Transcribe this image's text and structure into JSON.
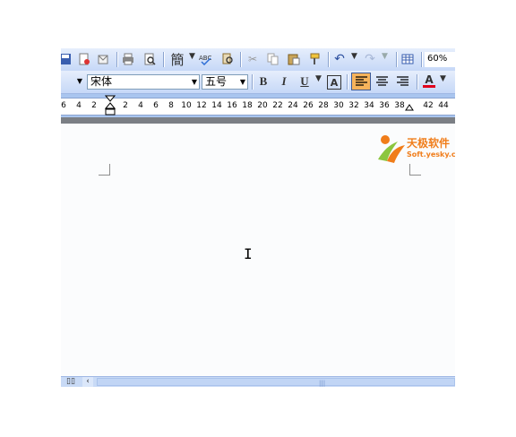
{
  "toolbar": {
    "simplified_char": "簡",
    "zoom": "60%",
    "icons": [
      "save-icon",
      "permission-icon",
      "print-icon",
      "print-preview-icon",
      "simplified-chinese-icon",
      "spelling-icon",
      "research-icon",
      "cut-icon",
      "copy-icon",
      "paste-icon",
      "format-painter-icon",
      "undo-icon",
      "redo-icon",
      "insert-table-icon"
    ]
  },
  "formatting": {
    "font_name": "宋体",
    "font_size": "五号",
    "bold": "B",
    "italic": "I",
    "underline": "U",
    "char_border": "A",
    "font_color": "A",
    "font_color_hex": "#e0001b",
    "active_align": "align-left"
  },
  "ruler": {
    "left_labels": [
      "6",
      "4",
      "2"
    ],
    "right_labels": [
      "2",
      "4",
      "6",
      "8",
      "10",
      "12",
      "14",
      "16",
      "18",
      "20",
      "22",
      "24",
      "26",
      "28",
      "30",
      "32",
      "34",
      "36",
      "38"
    ],
    "tail_labels": [
      "42",
      "44"
    ]
  },
  "watermark": {
    "text_cn": "天极软件",
    "text_en": "Soft.yesky.com",
    "brand_color": "#f07d1a"
  }
}
